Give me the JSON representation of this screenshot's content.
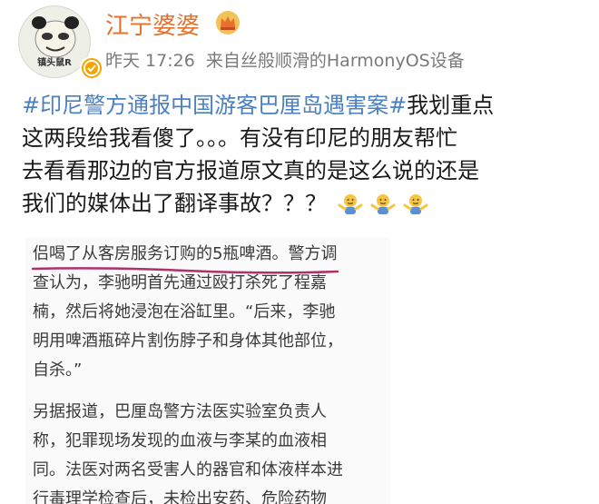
{
  "post": {
    "author_name": "江宁婆婆",
    "avatar_caption": "镇头鼠R",
    "time": "昨天 17:26",
    "source": "来自丝般顺滑的HarmonyOS设备",
    "hashtag": "#印尼警方通报中国游客巴厘岛遇害案#",
    "body_line1_rest": "我划重点",
    "body_line2": "这两段给我看傻了。。。有没有印尼的朋友帮忙",
    "body_line3": "去看看那边的官方报道原文真的是这么说的还是",
    "body_line4": "我们的媒体出了翻译事故？？？",
    "emojis": [
      "shrug-emoji",
      "shrug-emoji",
      "shrug-emoji"
    ]
  },
  "embed": {
    "para1_lines": [
      "侣喝了从客房服务订购的5瓶啤酒。警方调",
      "查认为，李驰明首先通过殴打杀死了程嘉",
      "楠，然后将她浸泡在浴缸里。“后来，李驰",
      "明用啤酒瓶碎片割伤脖子和身体其他部位，",
      "自杀。”"
    ],
    "para2_lines": [
      "另据报道，巴厘岛警方法医实验室负责人",
      "称，犯罪现场发现的血液与李某的血液相",
      "同。法医对两名受害人的器官和体液样本进",
      "行毒理学检查后，未检出安药、危险药物"
    ]
  },
  "colors": {
    "username": "#e8702a",
    "hashtag": "#4a7fc0",
    "meta": "#7a7a7a",
    "underline": "#b0306a"
  }
}
